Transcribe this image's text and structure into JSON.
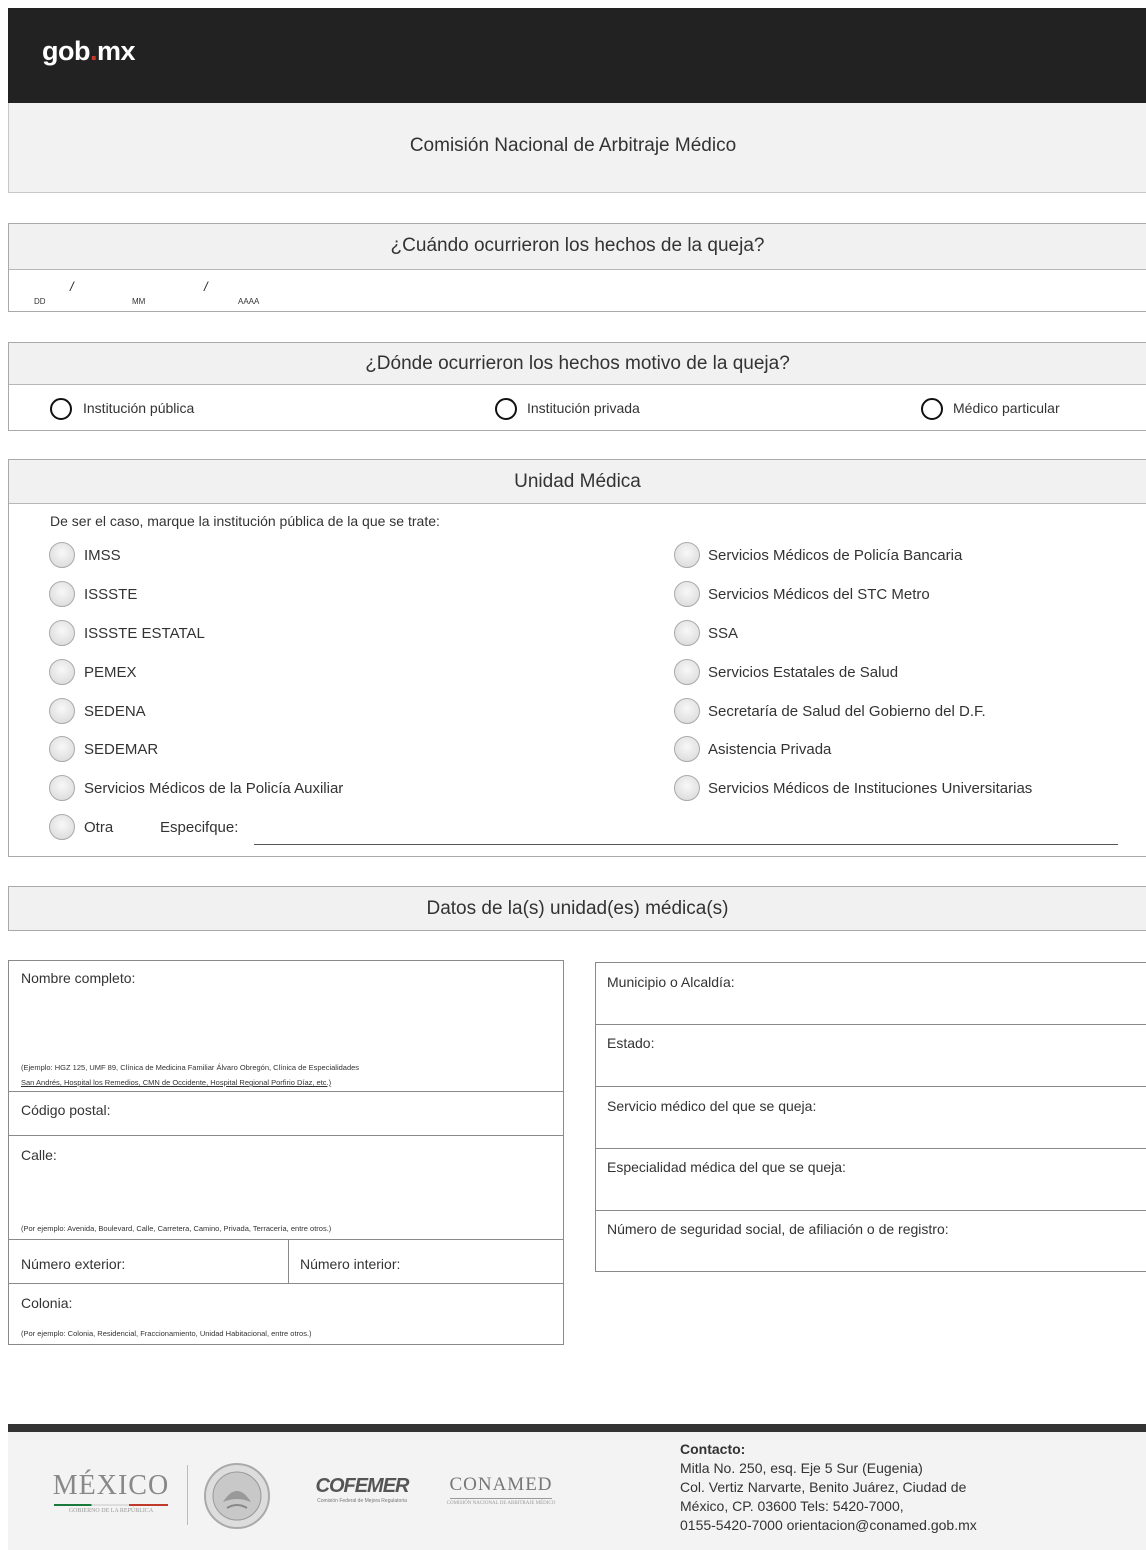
{
  "header": {
    "logo_text": "gob",
    "logo_dot": ".",
    "logo_suffix": "mx",
    "agency_title": "Comisión Nacional de Arbitraje Médico"
  },
  "when": {
    "title": "¿Cuándo ocurrieron los hechos de la queja?",
    "dd": "DD",
    "mm": "MM",
    "yyyy": "AAAA",
    "sep": "/"
  },
  "where": {
    "title": "¿Dónde ocurrieron los hechos motivo de la queja?",
    "options": [
      "Institución pública",
      "Institución privada",
      "Médico particular"
    ]
  },
  "unidad": {
    "title": "Unidad Médica",
    "instruction": "De ser el caso, marque la institución pública de la que se trate:",
    "left_options": [
      "IMSS",
      "ISSSTE",
      "ISSSTE ESTATAL",
      "PEMEX",
      "SEDENA",
      "SEDEMAR",
      "Servicios Médicos de la Policía Auxiliar",
      "Otra"
    ],
    "right_options": [
      "Servicios Médicos de Policía Bancaria",
      "Servicios Médicos del STC Metro",
      "SSA",
      "Servicios Estatales de Salud",
      "Secretaría de Salud del Gobierno del D.F.",
      "Asistencia Privada",
      "Servicios Médicos de Instituciones Universitarias"
    ],
    "specify_label": "Especifque:"
  },
  "datos": {
    "title": "Datos de la(s) unidad(es) médica(s)",
    "left": {
      "nombre_label": "Nombre completo:",
      "nombre_note_1": "(Ejemplo: HGZ 125, UMF 89, Clínica de Medicina Familiar Álvaro Obregón, Clínica de Especialidades",
      "nombre_note_2": "San Andrés, Hospital los Remedios, CMN de Occidente, Hospital Regional Porfirio Díaz, etc.)",
      "cp_label": "Código postal:",
      "calle_label": "Calle:",
      "calle_note": "(Por ejemplo: Avenida, Boulevard, Calle, Carretera, Camino, Privada, Terracería, entre otros.)",
      "num_ext_label": "Número exterior:",
      "num_int_label": "Número interior:",
      "colonia_label": "Colonia:",
      "colonia_note": "(Por ejemplo: Colonia, Residencial, Fraccionamiento, Unidad Habitacional, entre otros.)"
    },
    "right": {
      "municipio_label": "Municipio o Alcaldía:",
      "estado_label": "Estado:",
      "servicio_label": "Servicio médico del que se queja:",
      "especialidad_label": "Especialidad médica del que se queja:",
      "nss_label": "Número de seguridad social, de afiliación o de registro:"
    }
  },
  "footer": {
    "mexico_logo": "MÉXICO",
    "mexico_sub": "GOBIERNO DE LA REPÚBLICA",
    "cofemer_logo": "COFEMER",
    "cofemer_sub": "Comisión Federal de Mejora Regulatoria",
    "conamed_logo": "CONAMED",
    "conamed_sub": "COMISIÓN NACIONAL DE ARBITRAJE MÉDICO",
    "contact_title": "Contacto:",
    "contact_lines": [
      "Mitla No. 250, esq. Eje 5 Sur (Eugenia)",
      "Col. Vertiz Narvarte, Benito Juárez, Ciudad de",
      "México, CP. 03600 Tels: 5420-7000,",
      "0155-5420-7000 orientacion@conamed.gob.mx"
    ]
  }
}
